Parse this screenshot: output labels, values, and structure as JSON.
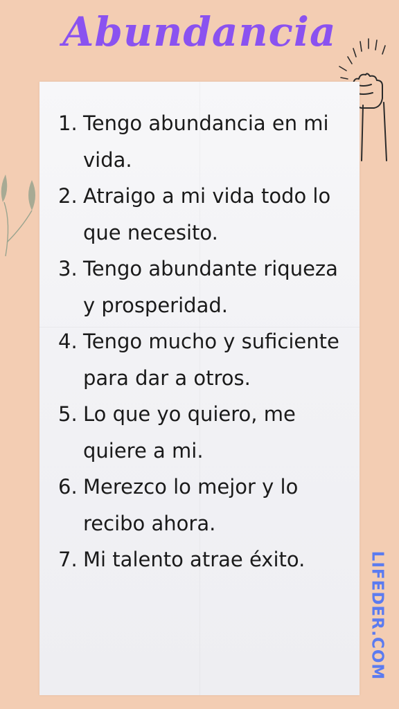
{
  "title": "Abundancia",
  "items": [
    {
      "number": "1.",
      "text": "Tengo abundancia en mi vida."
    },
    {
      "number": "2.",
      "text": "Atraigo a mi vida todo lo que necesito."
    },
    {
      "number": "3.",
      "text": "Tengo abundante riqueza y prosperidad."
    },
    {
      "number": "4.",
      "text": "Tengo mucho y suficiente para dar a otros."
    },
    {
      "number": "5.",
      "text": "Lo que yo quiero, me quiere a mi."
    },
    {
      "number": "6.",
      "text": "Merezco lo mejor y lo recibo ahora."
    },
    {
      "number": "7.",
      "text": "Mi talento atrae éxito."
    }
  ],
  "brand": "LIFEDER.COM",
  "icons": [
    "raised-fist-icon",
    "leaf-branch-icon"
  ],
  "colors": {
    "background": "#f3cdb3",
    "title": "#8a52f0",
    "brand": "#5b7bf0",
    "paper": "#f4f4f7",
    "text": "#1a1a1a"
  }
}
